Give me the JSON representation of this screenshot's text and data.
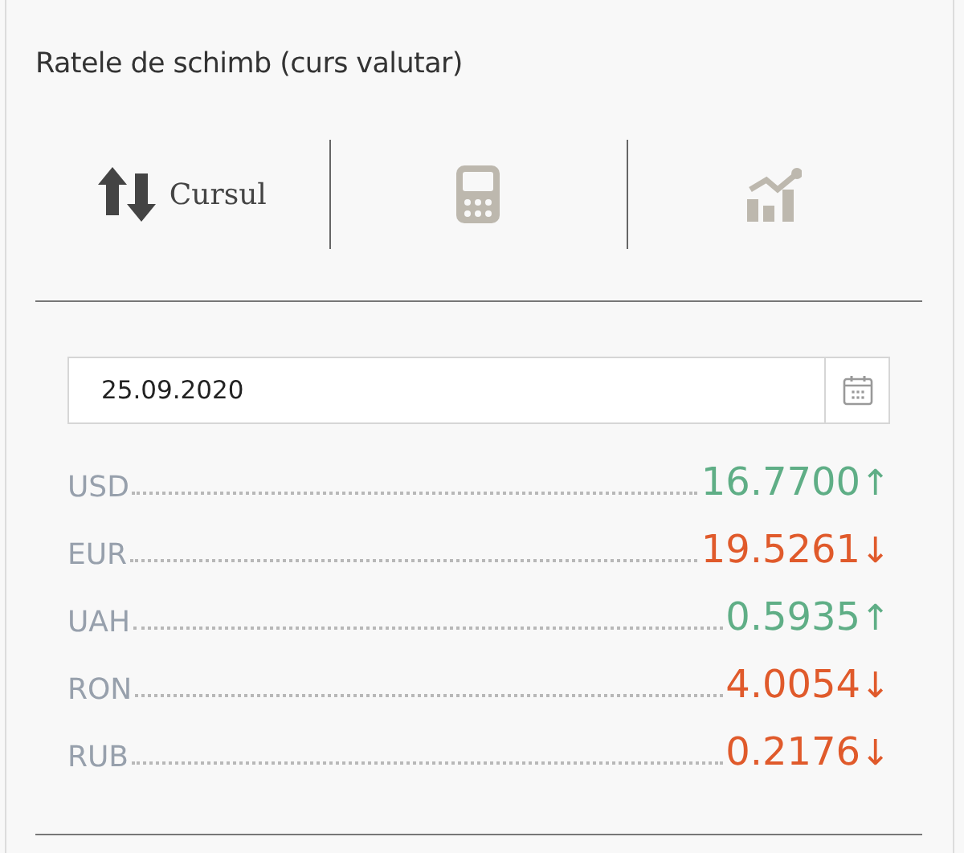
{
  "title": "Ratele de schimb (curs valutar)",
  "tabs": [
    {
      "kind": "rates",
      "label": "Cursul",
      "selected": true
    },
    {
      "kind": "calculator",
      "selected": false
    },
    {
      "kind": "chart",
      "selected": false
    }
  ],
  "date_field": {
    "value": "25.09.2020"
  },
  "rates": [
    {
      "currency": "USD",
      "value": "16.7700",
      "arrow": "↑",
      "rising": true
    },
    {
      "currency": "EUR",
      "value": "19.5261",
      "arrow": "↓",
      "rising": false
    },
    {
      "currency": "UAH",
      "value": "0.5935",
      "arrow": "↑",
      "rising": true
    },
    {
      "currency": "RON",
      "value": "4.0054",
      "arrow": "↓",
      "rising": false
    },
    {
      "currency": "RUB",
      "value": "0.2176",
      "arrow": "↓",
      "rising": false
    }
  ]
}
